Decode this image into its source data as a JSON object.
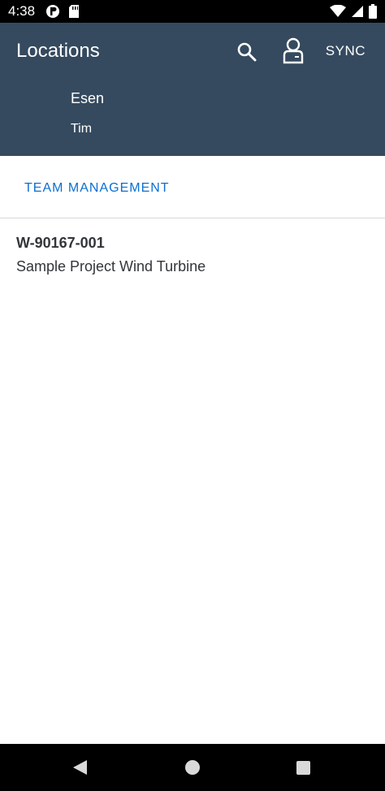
{
  "status_bar": {
    "time": "4:38",
    "left_icons": [
      "vpn-key-icon",
      "sd-card-icon"
    ],
    "right_icons": [
      "wifi-icon",
      "cell-signal-icon",
      "battery-icon"
    ]
  },
  "header": {
    "title": "Locations",
    "search_icon": "search-icon",
    "user_icon": "user-icon",
    "sync_label": "SYNC",
    "user_first": "Esen",
    "user_second": "Tim",
    "background_color": "#354a5f"
  },
  "team_management": {
    "label": "TEAM MANAGEMENT",
    "color": "#0a6ed1"
  },
  "locations": [
    {
      "id": "W-90167-001",
      "name": "Sample Project Wind Turbine"
    }
  ],
  "nav_bar": {
    "buttons": [
      "back-icon",
      "home-icon",
      "recents-icon"
    ]
  }
}
